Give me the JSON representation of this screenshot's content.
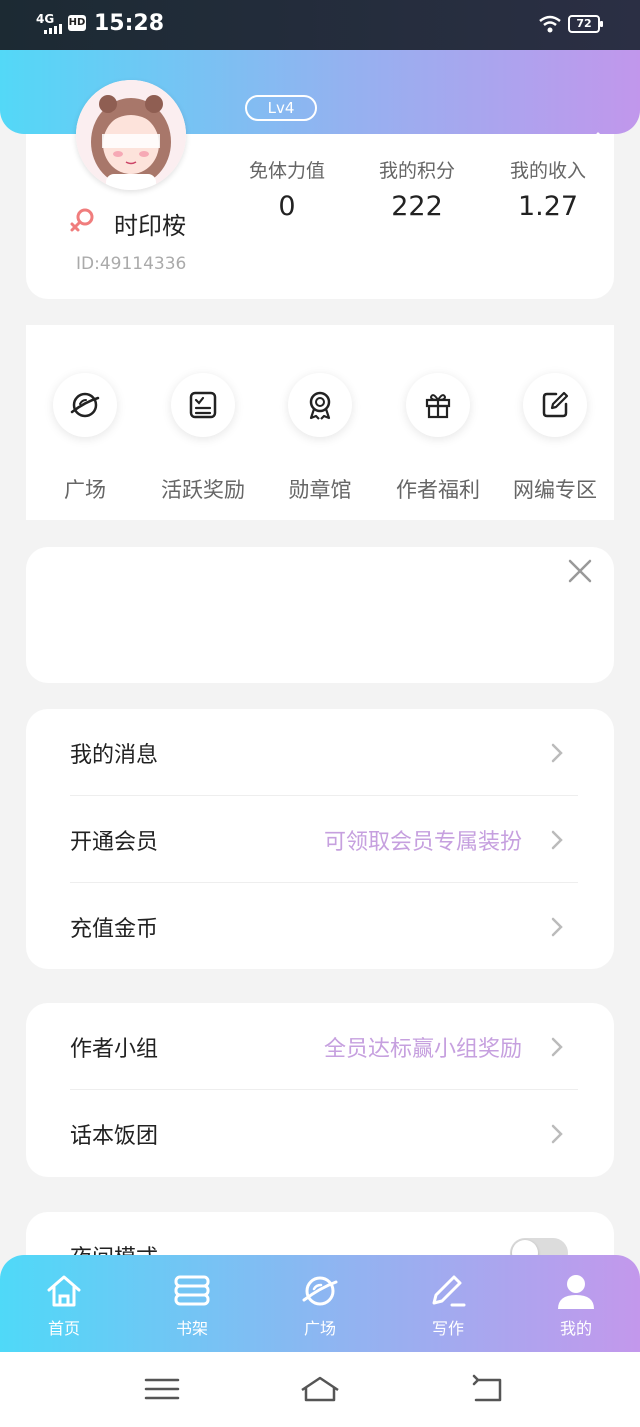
{
  "status_bar": {
    "network": "4G",
    "hd": "HD",
    "time": "15:28",
    "battery": "72"
  },
  "profile": {
    "level": "Lv4",
    "username": "时印桉",
    "user_id": "ID:49114336",
    "stats": [
      {
        "label": "免体力值",
        "value": "0"
      },
      {
        "label": "我的积分",
        "value": "222"
      },
      {
        "label": "我的收入",
        "value": "1.27"
      }
    ]
  },
  "quick_actions": [
    {
      "label": "广场",
      "icon": "planet-icon"
    },
    {
      "label": "活跃奖励",
      "icon": "checklist-icon"
    },
    {
      "label": "勋章馆",
      "icon": "medal-icon"
    },
    {
      "label": "作者福利",
      "icon": "gift-icon"
    },
    {
      "label": "网编专区",
      "icon": "edit-icon"
    }
  ],
  "menu_group1": [
    {
      "label": "我的消息",
      "hint": ""
    },
    {
      "label": "开通会员",
      "hint": "可领取会员专属装扮"
    },
    {
      "label": "充值金币",
      "hint": ""
    }
  ],
  "menu_group2": [
    {
      "label": "作者小组",
      "hint": "全员达标赢小组奖励"
    },
    {
      "label": "话本饭团",
      "hint": ""
    }
  ],
  "menu_group3": [
    {
      "label": "夜间模式"
    }
  ],
  "tabs": [
    {
      "label": "首页",
      "icon": "home-icon"
    },
    {
      "label": "书架",
      "icon": "bookshelf-icon"
    },
    {
      "label": "广场",
      "icon": "planet-icon"
    },
    {
      "label": "写作",
      "icon": "pen-icon"
    },
    {
      "label": "我的",
      "icon": "user-icon",
      "active": true
    }
  ],
  "colors": {
    "accent_start": "#53d8f7",
    "accent_end": "#c197ec",
    "hint": "#c6a0df"
  }
}
